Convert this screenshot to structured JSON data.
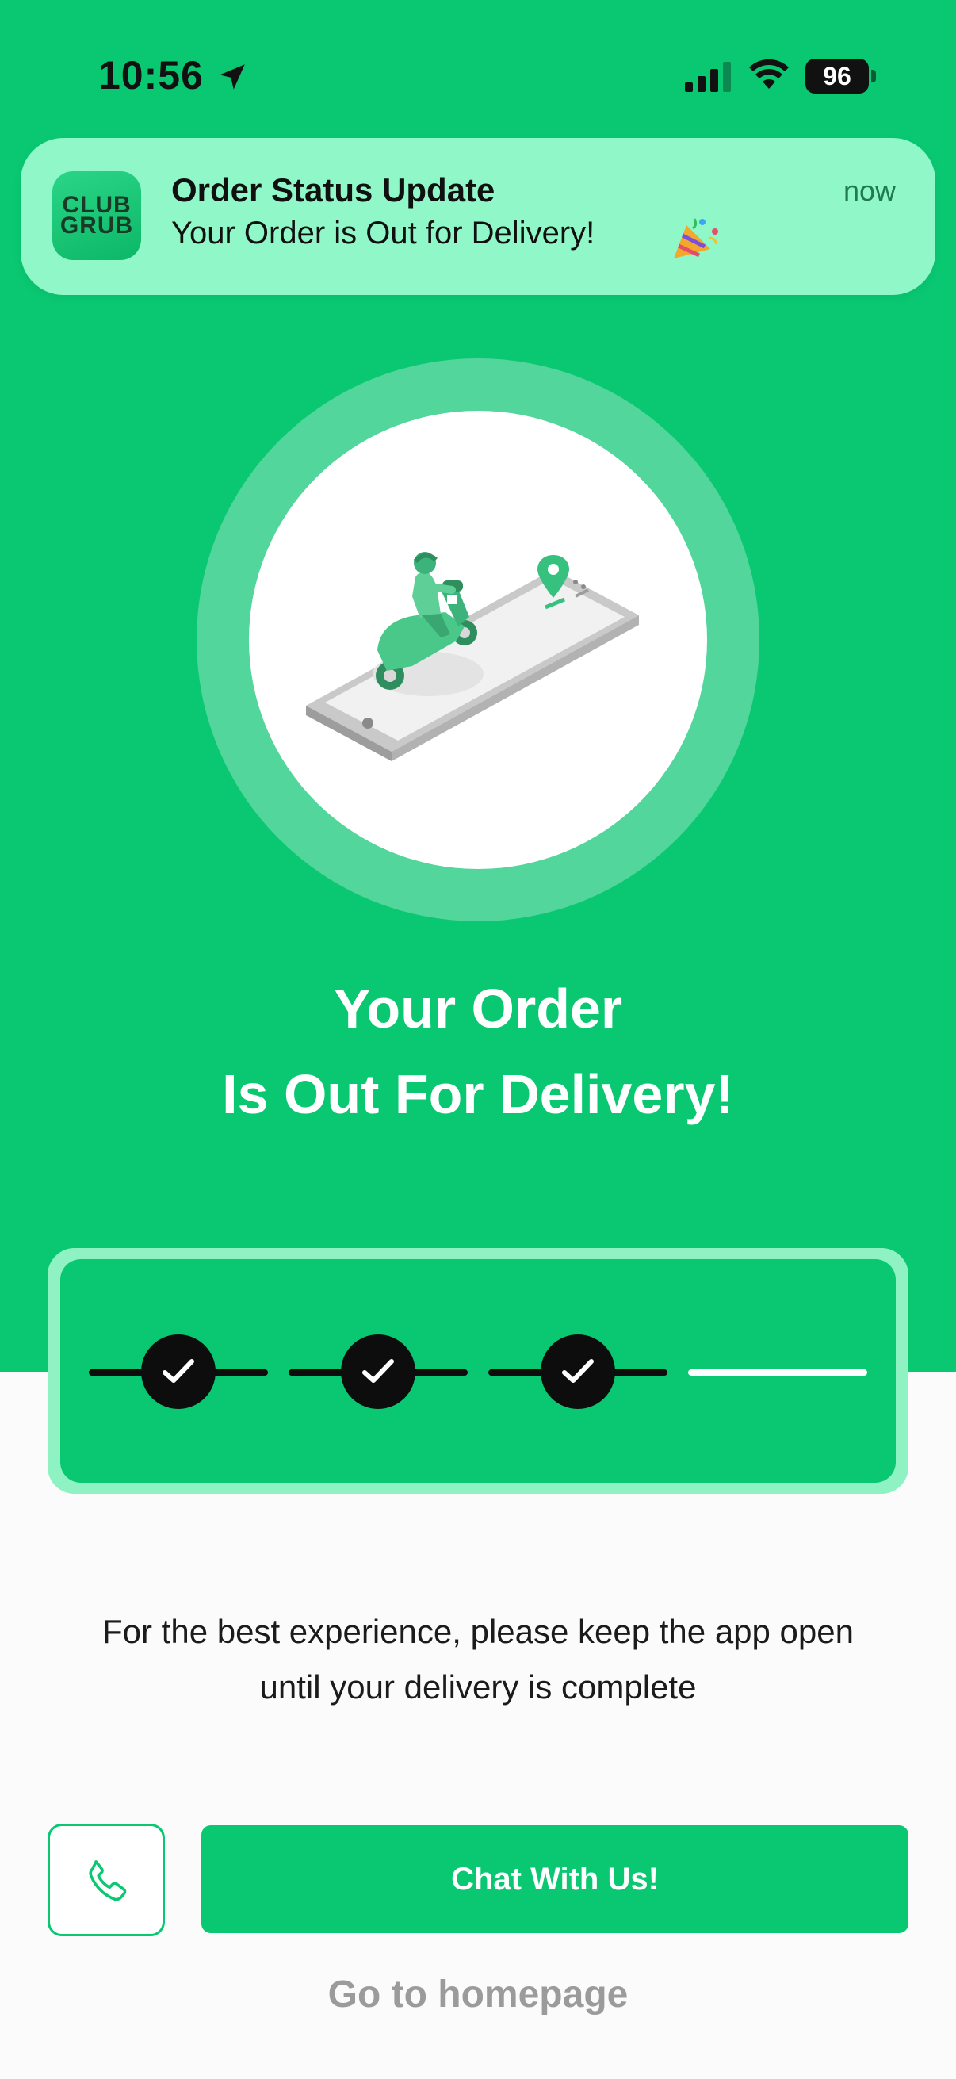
{
  "status_bar": {
    "time": "10:56",
    "battery": "96",
    "icons": [
      "location-arrow-icon",
      "signal-icon",
      "wifi-icon",
      "battery-icon"
    ]
  },
  "notification": {
    "app_icon_text": [
      "CLUB",
      "GRUB"
    ],
    "title": "Order Status Update",
    "body": "Your Order is Out for Delivery!",
    "time": "now",
    "emoji_icon": "party-popper-icon"
  },
  "hero": {
    "illustration": "delivery-scooter-phone-illustration",
    "headline_line1": "Your Order",
    "headline_line2": "Is Out For Delivery!"
  },
  "progress": {
    "steps_total": 4,
    "steps_completed": 3
  },
  "info": {
    "line1": "For the best experience, please keep the app open",
    "line2": "until your delivery is complete"
  },
  "actions": {
    "call_icon": "phone-icon",
    "chat_label": "Chat With Us!",
    "home_label": "Go to homepage"
  },
  "colors": {
    "brand_green": "#0ac872",
    "notification_bg": "#8ff7c8",
    "ring": "#52d69c",
    "muted_link": "#9b9b9b"
  }
}
